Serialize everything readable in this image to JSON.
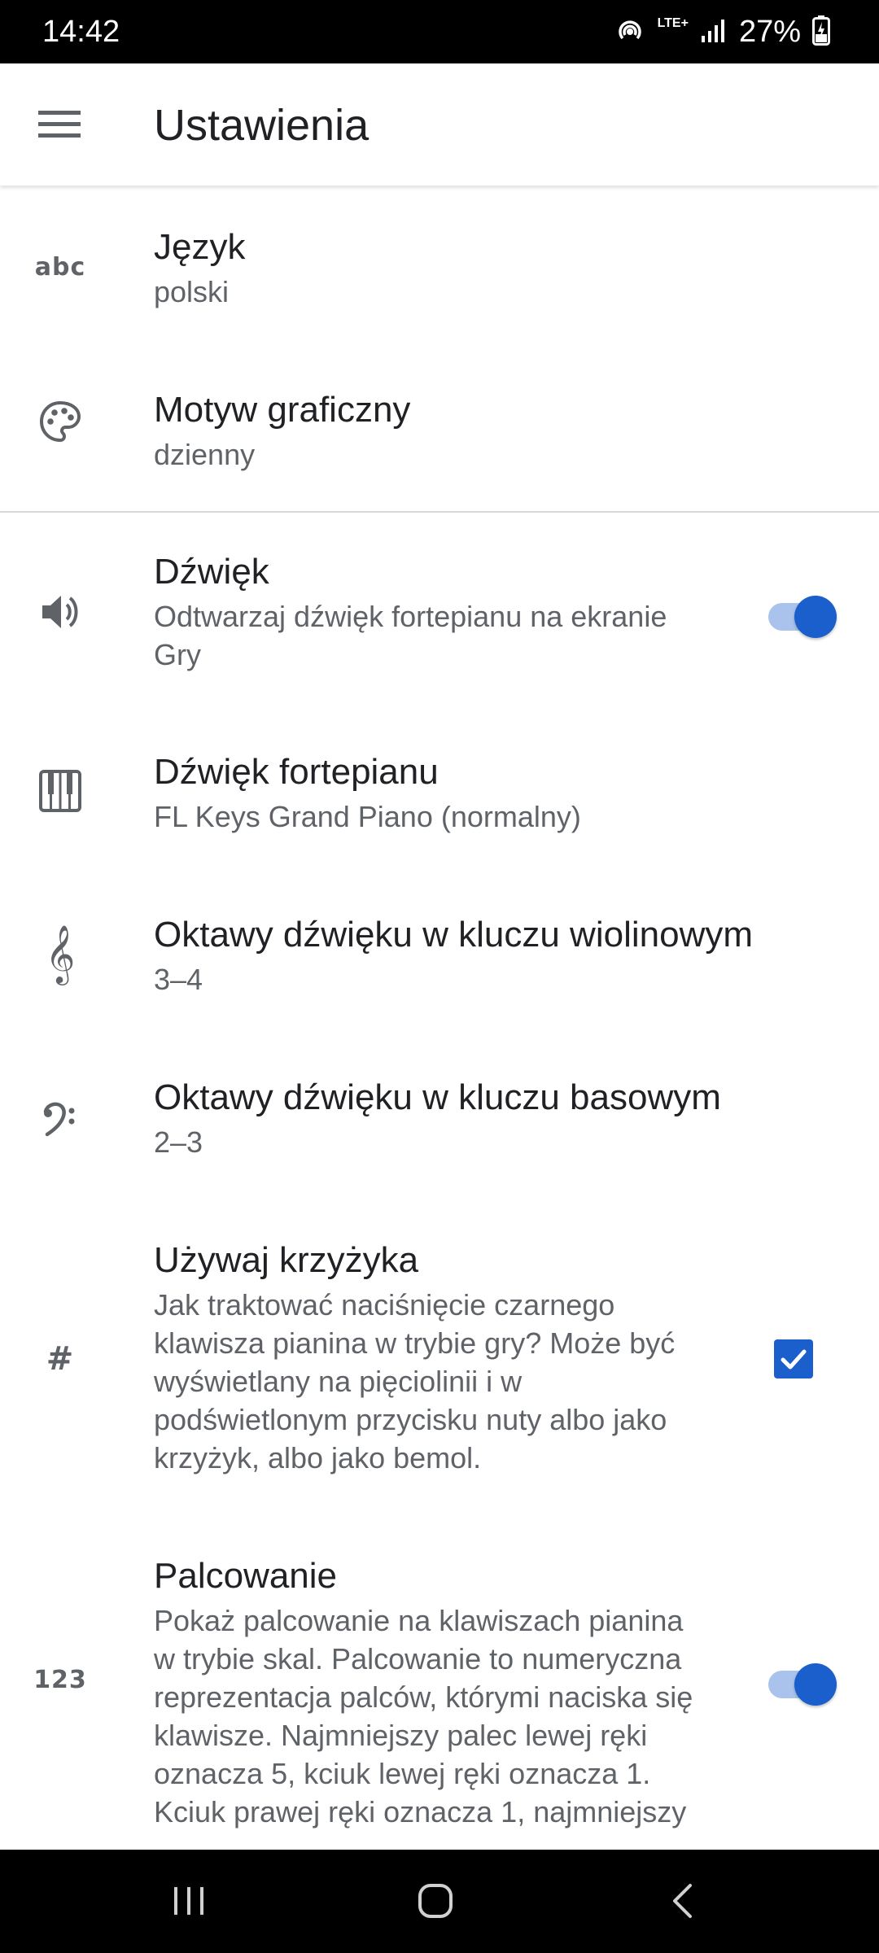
{
  "status_bar": {
    "time": "14:42",
    "network": "LTE+",
    "battery": "27%"
  },
  "app_bar": {
    "title": "Ustawienia",
    "menu_icon": "hamburger-menu-icon"
  },
  "settings": [
    {
      "id": "language",
      "icon": "abc-icon",
      "icon_text": "abc",
      "title": "Język",
      "summary": "polski"
    },
    {
      "id": "theme",
      "icon": "palette-icon",
      "title": "Motyw graficzny",
      "summary": "dzienny"
    },
    {
      "id": "sound",
      "icon": "volume-icon",
      "title": "Dźwięk",
      "summary": "Odtwarzaj dźwięk fortepianu na ekranie Gry",
      "switch_on": true
    },
    {
      "id": "piano-sound",
      "icon": "piano-keys-icon",
      "title": "Dźwięk fortepianu",
      "summary": "FL Keys Grand Piano (normalny)"
    },
    {
      "id": "treble-octaves",
      "icon": "treble-clef-icon",
      "title": "Oktawy dźwięku w kluczu wiolinowym",
      "summary": "3–4"
    },
    {
      "id": "bass-octaves",
      "icon": "bass-clef-icon",
      "title": "Oktawy dźwięku w kluczu basowym",
      "summary": "2–3"
    },
    {
      "id": "use-sharp",
      "icon": "sharp-icon",
      "title": "Używaj krzyżyka",
      "summary": "Jak traktować naciśnięcie czarnego klawisza pianina w trybie gry? Może być wyświetlany na pięciolinii i w podświetlonym przycisku nuty albo jako krzyżyk, albo jako bemol.",
      "checkbox_checked": true
    },
    {
      "id": "fingering",
      "icon": "numbers-icon",
      "icon_text": "123",
      "title": "Palcowanie",
      "summary": "Pokaż palcowanie na klawiszach pianina w trybie skal. Palcowanie to numeryczna reprezentacja palców, którymi naciska się klawisze. Najmniejszy palec lewej ręki oznacza 5, kciuk lewej ręki oznacza 1. Kciuk prawej ręki oznacza 1, najmniejszy",
      "switch_on": true
    }
  ],
  "colors": {
    "accent": "#1a5fcc",
    "accent_track": "#a9c3ec",
    "icon": "#5f6368",
    "summary_text": "#5f6368"
  },
  "nav_bar": {
    "recents": "recents-icon",
    "home": "home-icon",
    "back": "back-icon"
  }
}
